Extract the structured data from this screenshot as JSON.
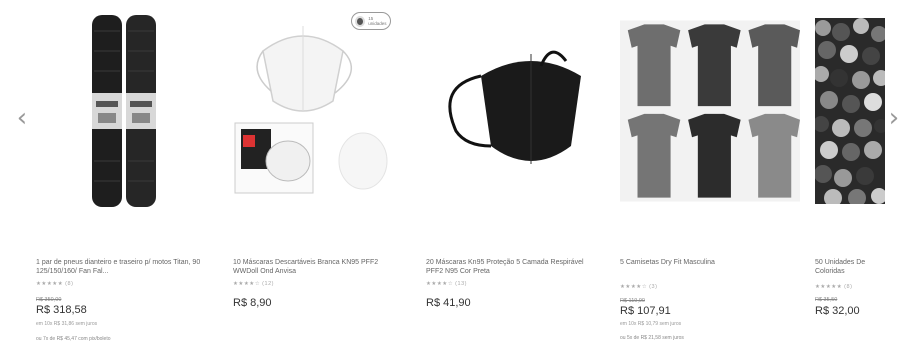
{
  "nav": {
    "prev_icon": "chevron-left-icon",
    "prev_glyph": "‹",
    "next_icon": "chevron-right-icon",
    "next_glyph": "›"
  },
  "products": [
    {
      "title": "1 par de pneus dianteiro e traseiro p/ motos Titan, 90 125/150/160/ Fan Fal...",
      "rating": "★★★★★ (8)",
      "old_price": "R$ 350,00",
      "price": "R$ 318,58",
      "installments": "em 10x R$ 31,86 sem juros",
      "pix": "ou 7x de R$ 45,47 com pix/boleto"
    },
    {
      "title": "10 Máscaras Descartáveis Branca KN95 PFF2 WWDoll Ond Anvisa",
      "rating": "★★★★☆ (12)",
      "price": "R$ 8,90",
      "badge": "15 unidades"
    },
    {
      "title": "20 Máscaras Kn95 Proteção 5 Camada Respirável PFF2 N95 Cor Preta",
      "rating": "★★★★☆ (13)",
      "price": "R$ 41,90"
    },
    {
      "title": "5 Camisetas Dry Fit Masculina",
      "rating": "★★★★☆ (3)",
      "old_price": "R$ 119,90",
      "price": "R$ 107,91",
      "installments": "em 10x R$ 10,79 sem juros",
      "pix": "ou 5x de R$ 21,58 sem juros"
    },
    {
      "title": "50 Unidades De Coloridas",
      "rating": "★★★★★ (8)",
      "old_price": "R$ 35,50",
      "price": "R$ 32,00"
    }
  ]
}
